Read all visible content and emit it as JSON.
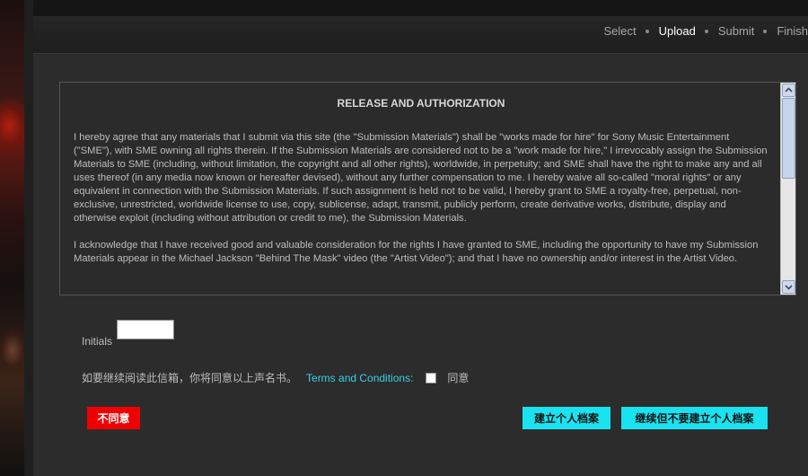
{
  "header": {
    "top_text": "",
    "steps": [
      {
        "label": "Select",
        "active": false
      },
      {
        "label": "Upload",
        "active": true
      },
      {
        "label": "Submit",
        "active": false
      },
      {
        "label": "Finish",
        "active": false
      }
    ]
  },
  "release": {
    "title": "RELEASE AND AUTHORIZATION",
    "paragraphs": [
      "I hereby agree that any materials that I submit via this site (the \"Submission Materials\") shall be \"works made for hire\" for Sony Music Entertainment (\"SME\"), with SME owning all rights therein. If the Submission Materials are considered not to be a \"work made for hire,\" I irrevocably assign the Submission Materials to SME (including, without limitation, the copyright and all other rights), worldwide, in perpetuity; and SME shall have the right to make any and all uses thereof (in any media now known or hereafter devised), without any further compensation to me. I hereby waive all so-called \"moral rights\" or any equivalent in connection with the Submission Materials. If such assignment is held not to be valid, I hereby grant to SME a royalty-free, perpetual, non-exclusive, unrestricted, worldwide license to use, copy, sublicense, adapt, transmit, publicly perform, create derivative works, distribute, display and otherwise exploit (including without attribution or credit to me), the Submission Materials.",
      "I acknowledge that I have received good and valuable consideration for the rights I have granted to SME, including the opportunity to have my Submission Materials appear in the Michael Jackson \"Behind The Mask\" video (the \"Artist Video\"); and that I have no ownership and/or interest in the Artist Video."
    ]
  },
  "form": {
    "initials_label": "Initials",
    "initials_value": "",
    "agree_text": "如要继续阅读此信箱，你将同意以上声名书。",
    "terms_link": "Terms and Conditions:",
    "agree_checked": false,
    "agree_label": "同意"
  },
  "buttons": {
    "disagree": "不同意",
    "create_profile": "建立个人档案",
    "continue_no_profile": "继续但不要建立个人档案"
  },
  "colors": {
    "accent_cyan": "#19e3f0",
    "disagree_red": "#ee0000",
    "link": "#39d0e6",
    "background": "#2c2c2c"
  }
}
